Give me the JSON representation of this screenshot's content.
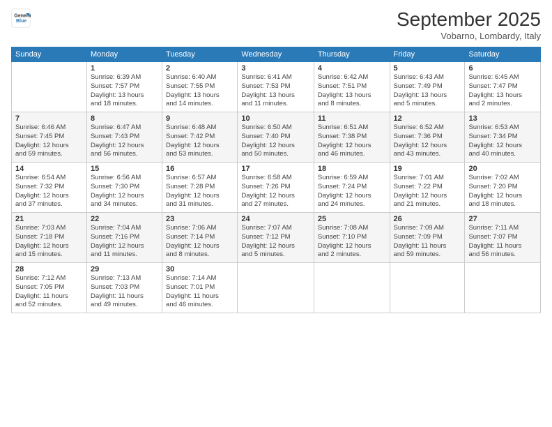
{
  "logo": {
    "general": "General",
    "blue": "Blue"
  },
  "header": {
    "month": "September 2025",
    "location": "Vobarno, Lombardy, Italy"
  },
  "days_of_week": [
    "Sunday",
    "Monday",
    "Tuesday",
    "Wednesday",
    "Thursday",
    "Friday",
    "Saturday"
  ],
  "weeks": [
    [
      {
        "day": "",
        "info": ""
      },
      {
        "day": "1",
        "info": "Sunrise: 6:39 AM\nSunset: 7:57 PM\nDaylight: 13 hours\nand 18 minutes."
      },
      {
        "day": "2",
        "info": "Sunrise: 6:40 AM\nSunset: 7:55 PM\nDaylight: 13 hours\nand 14 minutes."
      },
      {
        "day": "3",
        "info": "Sunrise: 6:41 AM\nSunset: 7:53 PM\nDaylight: 13 hours\nand 11 minutes."
      },
      {
        "day": "4",
        "info": "Sunrise: 6:42 AM\nSunset: 7:51 PM\nDaylight: 13 hours\nand 8 minutes."
      },
      {
        "day": "5",
        "info": "Sunrise: 6:43 AM\nSunset: 7:49 PM\nDaylight: 13 hours\nand 5 minutes."
      },
      {
        "day": "6",
        "info": "Sunrise: 6:45 AM\nSunset: 7:47 PM\nDaylight: 13 hours\nand 2 minutes."
      }
    ],
    [
      {
        "day": "7",
        "info": "Sunrise: 6:46 AM\nSunset: 7:45 PM\nDaylight: 12 hours\nand 59 minutes."
      },
      {
        "day": "8",
        "info": "Sunrise: 6:47 AM\nSunset: 7:43 PM\nDaylight: 12 hours\nand 56 minutes."
      },
      {
        "day": "9",
        "info": "Sunrise: 6:48 AM\nSunset: 7:42 PM\nDaylight: 12 hours\nand 53 minutes."
      },
      {
        "day": "10",
        "info": "Sunrise: 6:50 AM\nSunset: 7:40 PM\nDaylight: 12 hours\nand 50 minutes."
      },
      {
        "day": "11",
        "info": "Sunrise: 6:51 AM\nSunset: 7:38 PM\nDaylight: 12 hours\nand 46 minutes."
      },
      {
        "day": "12",
        "info": "Sunrise: 6:52 AM\nSunset: 7:36 PM\nDaylight: 12 hours\nand 43 minutes."
      },
      {
        "day": "13",
        "info": "Sunrise: 6:53 AM\nSunset: 7:34 PM\nDaylight: 12 hours\nand 40 minutes."
      }
    ],
    [
      {
        "day": "14",
        "info": "Sunrise: 6:54 AM\nSunset: 7:32 PM\nDaylight: 12 hours\nand 37 minutes."
      },
      {
        "day": "15",
        "info": "Sunrise: 6:56 AM\nSunset: 7:30 PM\nDaylight: 12 hours\nand 34 minutes."
      },
      {
        "day": "16",
        "info": "Sunrise: 6:57 AM\nSunset: 7:28 PM\nDaylight: 12 hours\nand 31 minutes."
      },
      {
        "day": "17",
        "info": "Sunrise: 6:58 AM\nSunset: 7:26 PM\nDaylight: 12 hours\nand 27 minutes."
      },
      {
        "day": "18",
        "info": "Sunrise: 6:59 AM\nSunset: 7:24 PM\nDaylight: 12 hours\nand 24 minutes."
      },
      {
        "day": "19",
        "info": "Sunrise: 7:01 AM\nSunset: 7:22 PM\nDaylight: 12 hours\nand 21 minutes."
      },
      {
        "day": "20",
        "info": "Sunrise: 7:02 AM\nSunset: 7:20 PM\nDaylight: 12 hours\nand 18 minutes."
      }
    ],
    [
      {
        "day": "21",
        "info": "Sunrise: 7:03 AM\nSunset: 7:18 PM\nDaylight: 12 hours\nand 15 minutes."
      },
      {
        "day": "22",
        "info": "Sunrise: 7:04 AM\nSunset: 7:16 PM\nDaylight: 12 hours\nand 11 minutes."
      },
      {
        "day": "23",
        "info": "Sunrise: 7:06 AM\nSunset: 7:14 PM\nDaylight: 12 hours\nand 8 minutes."
      },
      {
        "day": "24",
        "info": "Sunrise: 7:07 AM\nSunset: 7:12 PM\nDaylight: 12 hours\nand 5 minutes."
      },
      {
        "day": "25",
        "info": "Sunrise: 7:08 AM\nSunset: 7:10 PM\nDaylight: 12 hours\nand 2 minutes."
      },
      {
        "day": "26",
        "info": "Sunrise: 7:09 AM\nSunset: 7:09 PM\nDaylight: 11 hours\nand 59 minutes."
      },
      {
        "day": "27",
        "info": "Sunrise: 7:11 AM\nSunset: 7:07 PM\nDaylight: 11 hours\nand 56 minutes."
      }
    ],
    [
      {
        "day": "28",
        "info": "Sunrise: 7:12 AM\nSunset: 7:05 PM\nDaylight: 11 hours\nand 52 minutes."
      },
      {
        "day": "29",
        "info": "Sunrise: 7:13 AM\nSunset: 7:03 PM\nDaylight: 11 hours\nand 49 minutes."
      },
      {
        "day": "30",
        "info": "Sunrise: 7:14 AM\nSunset: 7:01 PM\nDaylight: 11 hours\nand 46 minutes."
      },
      {
        "day": "",
        "info": ""
      },
      {
        "day": "",
        "info": ""
      },
      {
        "day": "",
        "info": ""
      },
      {
        "day": "",
        "info": ""
      }
    ]
  ]
}
